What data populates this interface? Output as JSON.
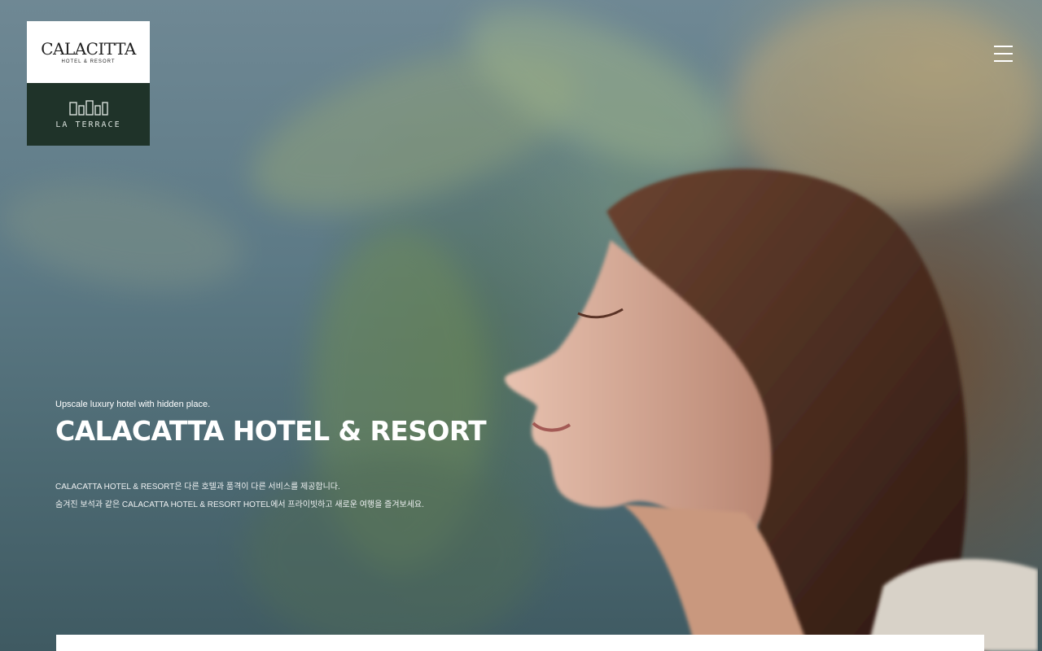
{
  "logo": {
    "brand": "CALACITTA",
    "sub": "HOTEL & RESORT",
    "secondary": "LA TERRACE"
  },
  "menu": {
    "icon": "hamburger-menu-icon"
  },
  "hero": {
    "tagline": "Upscale luxury hotel with hidden place.",
    "title": "CALACATTA HOTEL & RESORT",
    "desc_line1": "CALACATTA HOTEL & RESORT은 다른 호텔과 품격이 다른 서비스를 제공합니다.",
    "desc_line2": "숨겨진 보석과 같은 CALACATTA HOTEL & RESORT HOTEL에서 프라이빗하고 새로운 여행을 즐겨보세요."
  },
  "colors": {
    "logo_dark": "#1f3329",
    "text": "#ffffff"
  }
}
